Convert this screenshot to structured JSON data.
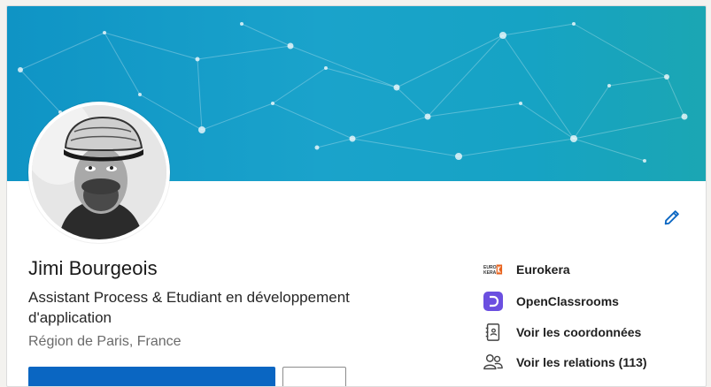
{
  "profile": {
    "name": "Jimi Bourgeois",
    "headline": "Assistant Process & Etudiant en développement d'application",
    "location": "Région de Paris, France"
  },
  "sidebar": {
    "items": [
      {
        "label": "Eurokera",
        "icon": "eurokera-logo",
        "logo_text": "EURO KERA"
      },
      {
        "label": "OpenClassrooms",
        "icon": "openclassrooms-logo"
      },
      {
        "label": "Voir les coordonnées",
        "icon": "contact-book-icon"
      },
      {
        "label": "Voir les relations (113)",
        "icon": "people-icon"
      }
    ]
  },
  "colors": {
    "banner_start": "#0f94c5",
    "banner_end": "#1ba6b3",
    "primary_button": "#0a66c2",
    "edit_icon": "#0a66c2",
    "openclassrooms_brand": "#6b4fe0",
    "eurokera_brand": "#e8621c"
  },
  "icons": {
    "edit": "pencil-icon"
  }
}
